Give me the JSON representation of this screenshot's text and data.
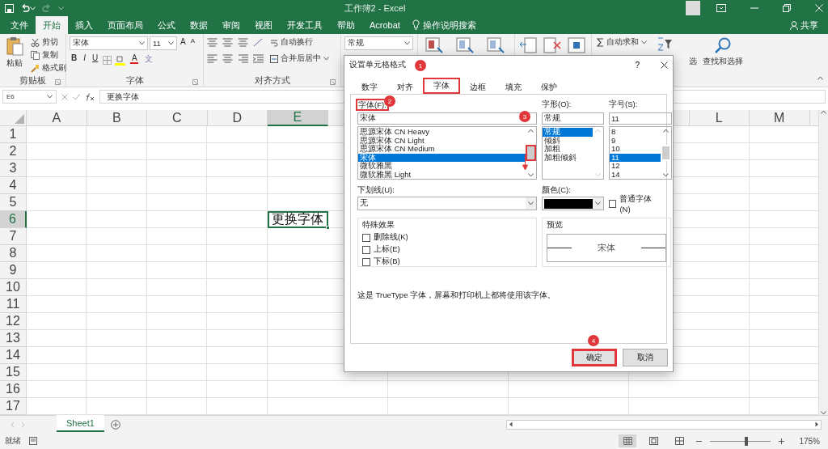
{
  "window": {
    "title": "工作簿2 - Excel",
    "share": "共享"
  },
  "ribbon_tabs": [
    {
      "label": "文件",
      "selected": false
    },
    {
      "label": "开始",
      "selected": true
    },
    {
      "label": "插入",
      "selected": false
    },
    {
      "label": "页面布局",
      "selected": false
    },
    {
      "label": "公式",
      "selected": false
    },
    {
      "label": "数据",
      "selected": false
    },
    {
      "label": "审阅",
      "selected": false
    },
    {
      "label": "视图",
      "selected": false
    },
    {
      "label": "开发工具",
      "selected": false
    },
    {
      "label": "帮助",
      "selected": false
    },
    {
      "label": "Acrobat",
      "selected": false
    }
  ],
  "tell_me": "操作说明搜索",
  "ribbon": {
    "clipboard": {
      "label": "剪贴板",
      "paste": "粘贴",
      "cut": "剪切",
      "copy": "复制",
      "format_painter": "格式刷"
    },
    "font": {
      "label": "字体",
      "name": "宋体",
      "size": "11",
      "grow": "A",
      "shrink": "A",
      "bold": "B",
      "italic": "I",
      "underline": "U",
      "font_color": "A",
      "phonetic": "文"
    },
    "alignment": {
      "label": "对齐方式",
      "wrap_text": "自动换行",
      "merge_center": "合并后居中"
    },
    "number": {
      "format": "常规"
    },
    "editing": {
      "autosum": "自动求和",
      "sort_filter": "选",
      "find_select": "查找和选择"
    }
  },
  "formula_bar": {
    "name_box": "E6",
    "content": "更换字体"
  },
  "sheet": {
    "columns_left": [
      {
        "label": "A",
        "selected": false
      },
      {
        "label": "B",
        "selected": false
      },
      {
        "label": "C",
        "selected": false
      },
      {
        "label": "D",
        "selected": false
      },
      {
        "label": "E",
        "selected": true
      }
    ],
    "columns_right": [
      {
        "label": "L",
        "selected": false
      },
      {
        "label": "M",
        "selected": false
      }
    ],
    "rows": [
      {
        "label": "1",
        "selected": false
      },
      {
        "label": "2",
        "selected": false
      },
      {
        "label": "3",
        "selected": false
      },
      {
        "label": "4",
        "selected": false
      },
      {
        "label": "5",
        "selected": false
      },
      {
        "label": "6",
        "selected": true
      },
      {
        "label": "7",
        "selected": false
      },
      {
        "label": "8",
        "selected": false
      },
      {
        "label": "9",
        "selected": false
      },
      {
        "label": "10",
        "selected": false
      },
      {
        "label": "11",
        "selected": false
      },
      {
        "label": "12",
        "selected": false
      },
      {
        "label": "13",
        "selected": false
      },
      {
        "label": "14",
        "selected": false
      },
      {
        "label": "15",
        "selected": false
      },
      {
        "label": "16",
        "selected": false
      },
      {
        "label": "17",
        "selected": false
      }
    ],
    "active_cell_text": "更换字体"
  },
  "sheet_tabs": [
    {
      "label": "Sheet1",
      "selected": true
    }
  ],
  "status_bar": {
    "text": "就绪",
    "zoom": "175%",
    "zoom_slider": {
      "level": 0.6
    }
  },
  "dialog": {
    "title": "设置单元格格式",
    "help": "?",
    "tabs": [
      {
        "label": "数字",
        "selected": false,
        "highlighted": false
      },
      {
        "label": "对齐",
        "selected": false,
        "highlighted": false
      },
      {
        "label": "字体",
        "selected": true,
        "highlighted": true
      },
      {
        "label": "边框",
        "selected": false,
        "highlighted": false
      },
      {
        "label": "填充",
        "selected": false,
        "highlighted": false
      },
      {
        "label": "保护",
        "selected": false,
        "highlighted": false
      }
    ],
    "font": {
      "label": "字体(F):",
      "highlighted": true,
      "value": "宋体",
      "scroll_highlighted": true,
      "items": [
        {
          "label": "思源宋体 CN Heavy",
          "selected": false
        },
        {
          "label": "思源宋体 CN Light",
          "selected": false
        },
        {
          "label": "思源宋体 CN Medium",
          "selected": false
        },
        {
          "label": "宋体",
          "selected": true
        },
        {
          "label": "微软雅黑",
          "selected": false
        },
        {
          "label": "微软雅黑 Light",
          "selected": false
        }
      ]
    },
    "style": {
      "label": "字形(O):",
      "value": "常规",
      "items": [
        {
          "label": "常规",
          "selected": true
        },
        {
          "label": "倾斜",
          "selected": false
        },
        {
          "label": "加粗",
          "selected": false
        },
        {
          "label": "加粗倾斜",
          "selected": false
        }
      ]
    },
    "size": {
      "label": "字号(S):",
      "value": "11",
      "items": [
        {
          "label": "8",
          "selected": false
        },
        {
          "label": "9",
          "selected": false
        },
        {
          "label": "10",
          "selected": false
        },
        {
          "label": "11",
          "selected": true
        },
        {
          "label": "12",
          "selected": false
        },
        {
          "label": "14",
          "selected": false
        }
      ]
    },
    "underline": {
      "label": "下划线(U):",
      "value": "无"
    },
    "color": {
      "label": "颜色(C):",
      "color": "#000000"
    },
    "normal_font": {
      "label": "普通字体(N)",
      "checked": false
    },
    "effects": {
      "label": "特殊效果",
      "items": [
        {
          "label": "删除线(K)",
          "checked": false
        },
        {
          "label": "上标(E)",
          "checked": false
        },
        {
          "label": "下标(B)",
          "checked": false
        }
      ]
    },
    "preview": {
      "label": "预览",
      "text": "宋体"
    },
    "note": "这是 TrueType 字体，屏幕和打印机上都将使用该字体。",
    "buttons": [
      {
        "label": "确定",
        "kind": "primary",
        "highlighted": true
      },
      {
        "label": "取消",
        "kind": "normal",
        "highlighted": false
      }
    ]
  },
  "annotations": [
    {
      "number": "1",
      "arrow": false
    },
    {
      "number": "2",
      "arrow": false
    },
    {
      "number": "3",
      "arrow": true
    },
    {
      "number": "4",
      "arrow": false
    }
  ]
}
